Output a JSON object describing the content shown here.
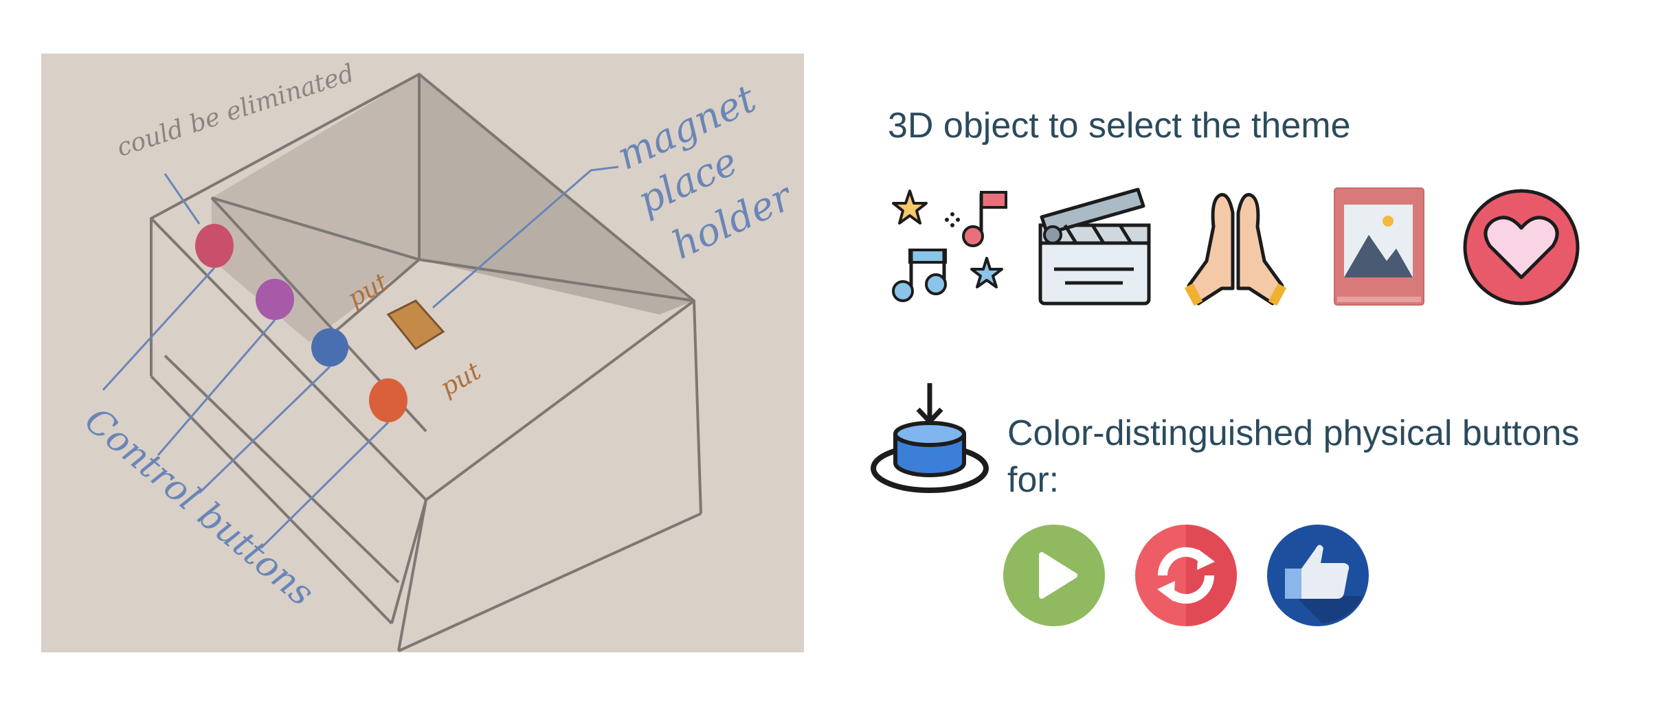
{
  "sketch": {
    "labels": {
      "could_be_eliminated": "could be eliminated",
      "magnet_placeholder": [
        "magnet",
        "place",
        "holder"
      ],
      "put_top": "put",
      "put_bottom": "put",
      "control_buttons": "Control buttons"
    },
    "button_colors": [
      "#c8506a",
      "#a65aa8",
      "#4a6fb0",
      "#d9603a"
    ]
  },
  "theme_section": {
    "heading": "3D object to select the theme",
    "icons": [
      "music-notes-icon",
      "clapperboard-icon",
      "praying-hands-icon",
      "picture-frame-icon",
      "heart-icon"
    ]
  },
  "buttons_section": {
    "heading_line1": "Color-distinguished physical buttons",
    "heading_line2": "for:",
    "icons": [
      "play-icon",
      "refresh-icon",
      "thumbs-up-icon"
    ],
    "colors": {
      "play": "#8fba5f",
      "refresh": "#ee5d65",
      "like": "#1d4f9f"
    }
  },
  "colors": {
    "text": "#2b4b5c",
    "sketch_paper": "#d9d0c8",
    "pencil": "#8a8580",
    "ink": "#6a86b6"
  }
}
